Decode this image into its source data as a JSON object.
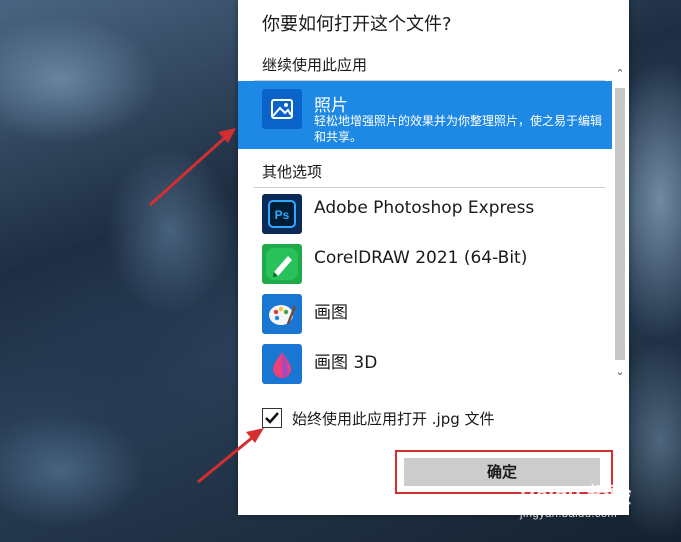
{
  "dialog": {
    "title": "你要如何打开这个文件?",
    "section_continue": "继续使用此应用",
    "selected_app": {
      "name": "照片",
      "description": "轻松地增强照片的效果并为你整理照片，使之易于编辑和共享。"
    },
    "section_other": "其他选项",
    "apps": [
      {
        "label": "Adobe Photoshop Express",
        "icon": "photoshop-express-icon"
      },
      {
        "label": "CorelDRAW 2021 (64-Bit)",
        "icon": "coreldraw-icon"
      },
      {
        "label": "画图",
        "icon": "paint-icon"
      },
      {
        "label": "画图 3D",
        "icon": "paint-3d-icon"
      }
    ],
    "checkbox_label": "始终使用此应用打开 .jpg 文件",
    "checkbox_checked": true,
    "ok_label": "确定"
  },
  "watermark": {
    "brand": "Baidu 经验",
    "url": "jingyan.baidu.com"
  },
  "colors": {
    "selected_bg": "#1e88e5",
    "annotation_red": "#d32f2f"
  }
}
